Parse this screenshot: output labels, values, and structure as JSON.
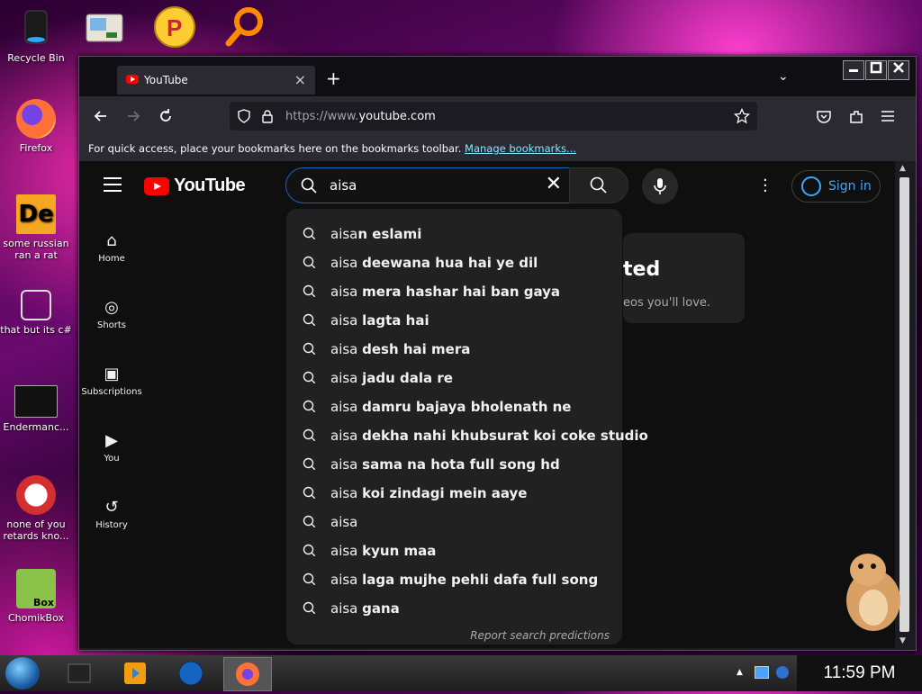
{
  "desktop": {
    "icons": [
      {
        "label": "Recycle Bin"
      },
      {
        "label": "Firefox"
      },
      {
        "label": "some russian ran a rat"
      },
      {
        "label": "that but its c#"
      },
      {
        "label": "Endermanc..."
      },
      {
        "label": "none of you retards kno..."
      },
      {
        "label": "ChomikBox"
      }
    ],
    "chomikbox_badge": "Box"
  },
  "browser": {
    "tab_title": "YouTube",
    "tab_close": "×",
    "new_tab": "+",
    "tab_list": "⌄",
    "url_scheme": "https://www.",
    "url_host": "youtube.com",
    "bookmarks_message": "For quick access, place your bookmarks here on the bookmarks toolbar.",
    "bookmarks_link": "Manage bookmarks..."
  },
  "youtube": {
    "logo_text": "YouTube",
    "search_query": "aisa",
    "clear_glyph": "✕",
    "sign_in": "Sign in",
    "sidebar": [
      {
        "label": "Home",
        "icon": "⌂"
      },
      {
        "label": "Shorts",
        "icon": "◎"
      },
      {
        "label": "Subscriptions",
        "icon": "▣"
      },
      {
        "label": "You",
        "icon": "▶"
      },
      {
        "label": "History",
        "icon": "↺"
      }
    ],
    "card_heading_fragment": "ted",
    "card_text_fragment": "eos you'll love.",
    "suggestions": [
      {
        "prefix": "aisa",
        "rest": "n eslami"
      },
      {
        "prefix": "aisa ",
        "rest": "deewana hua hai ye dil"
      },
      {
        "prefix": "aisa ",
        "rest": "mera hashar hai ban gaya"
      },
      {
        "prefix": "aisa ",
        "rest": "lagta hai"
      },
      {
        "prefix": "aisa ",
        "rest": "desh hai mera"
      },
      {
        "prefix": "aisa ",
        "rest": "jadu dala re"
      },
      {
        "prefix": "aisa ",
        "rest": "damru bajaya bholenath ne"
      },
      {
        "prefix": "aisa ",
        "rest": "dekha nahi khubsurat koi coke studio"
      },
      {
        "prefix": "aisa ",
        "rest": "sama na hota full song hd"
      },
      {
        "prefix": "aisa ",
        "rest": "koi zindagi mein aaye"
      },
      {
        "prefix": "aisa",
        "rest": ""
      },
      {
        "prefix": "aisa ",
        "rest": "kyun maa"
      },
      {
        "prefix": "aisa ",
        "rest": "laga mujhe pehli dafa full song"
      },
      {
        "prefix": "aisa ",
        "rest": "gana"
      }
    ],
    "report_link": "Report search predictions"
  },
  "taskbar": {
    "clock": "11:59 PM"
  }
}
